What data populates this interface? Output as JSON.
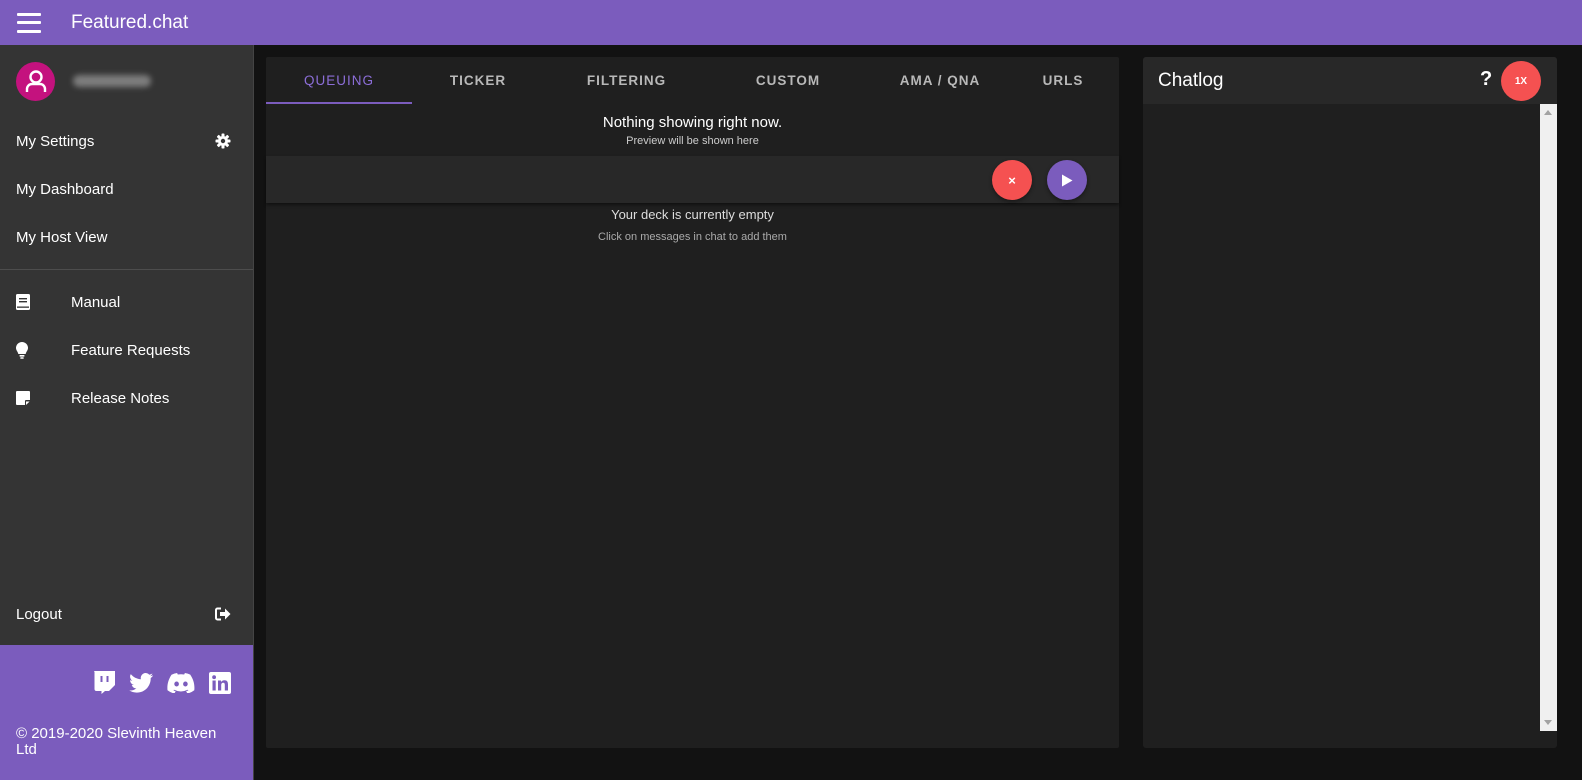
{
  "app": {
    "title": "Featured.chat"
  },
  "colors": {
    "brand": "#7b5cbd",
    "danger": "#f55151",
    "avatar": "#c4127e"
  },
  "sidebar": {
    "nav_top": [
      {
        "label": "My Settings",
        "icon": "gear-icon"
      },
      {
        "label": "My Dashboard"
      },
      {
        "label": "My Host View"
      }
    ],
    "nav_links": [
      {
        "label": "Manual",
        "icon": "book-icon"
      },
      {
        "label": "Feature Requests",
        "icon": "lightbulb-icon"
      },
      {
        "label": "Release Notes",
        "icon": "sticky-note-icon"
      }
    ],
    "logout": {
      "label": "Logout",
      "icon": "sign-out-icon"
    },
    "social": [
      "twitch-icon",
      "twitter-icon",
      "discord-icon",
      "linkedin-icon"
    ],
    "copyright": "© 2019-2020 Slevinth Heaven Ltd"
  },
  "main": {
    "tabs": [
      {
        "label": "QUEUING",
        "active": true
      },
      {
        "label": "TICKER"
      },
      {
        "label": "FILTERING"
      },
      {
        "label": "CUSTOM"
      },
      {
        "label": "AMA / QNA"
      },
      {
        "label": "URLS"
      }
    ],
    "preview_title": "Nothing showing right now.",
    "preview_subtitle": "Preview will be shown here",
    "clear_label": "×",
    "deck_title": "Your deck is currently empty",
    "deck_subtitle": "Click on messages in chat to add them"
  },
  "chat": {
    "title": "Chatlog",
    "help_label": "?",
    "speed_label": "1X"
  }
}
